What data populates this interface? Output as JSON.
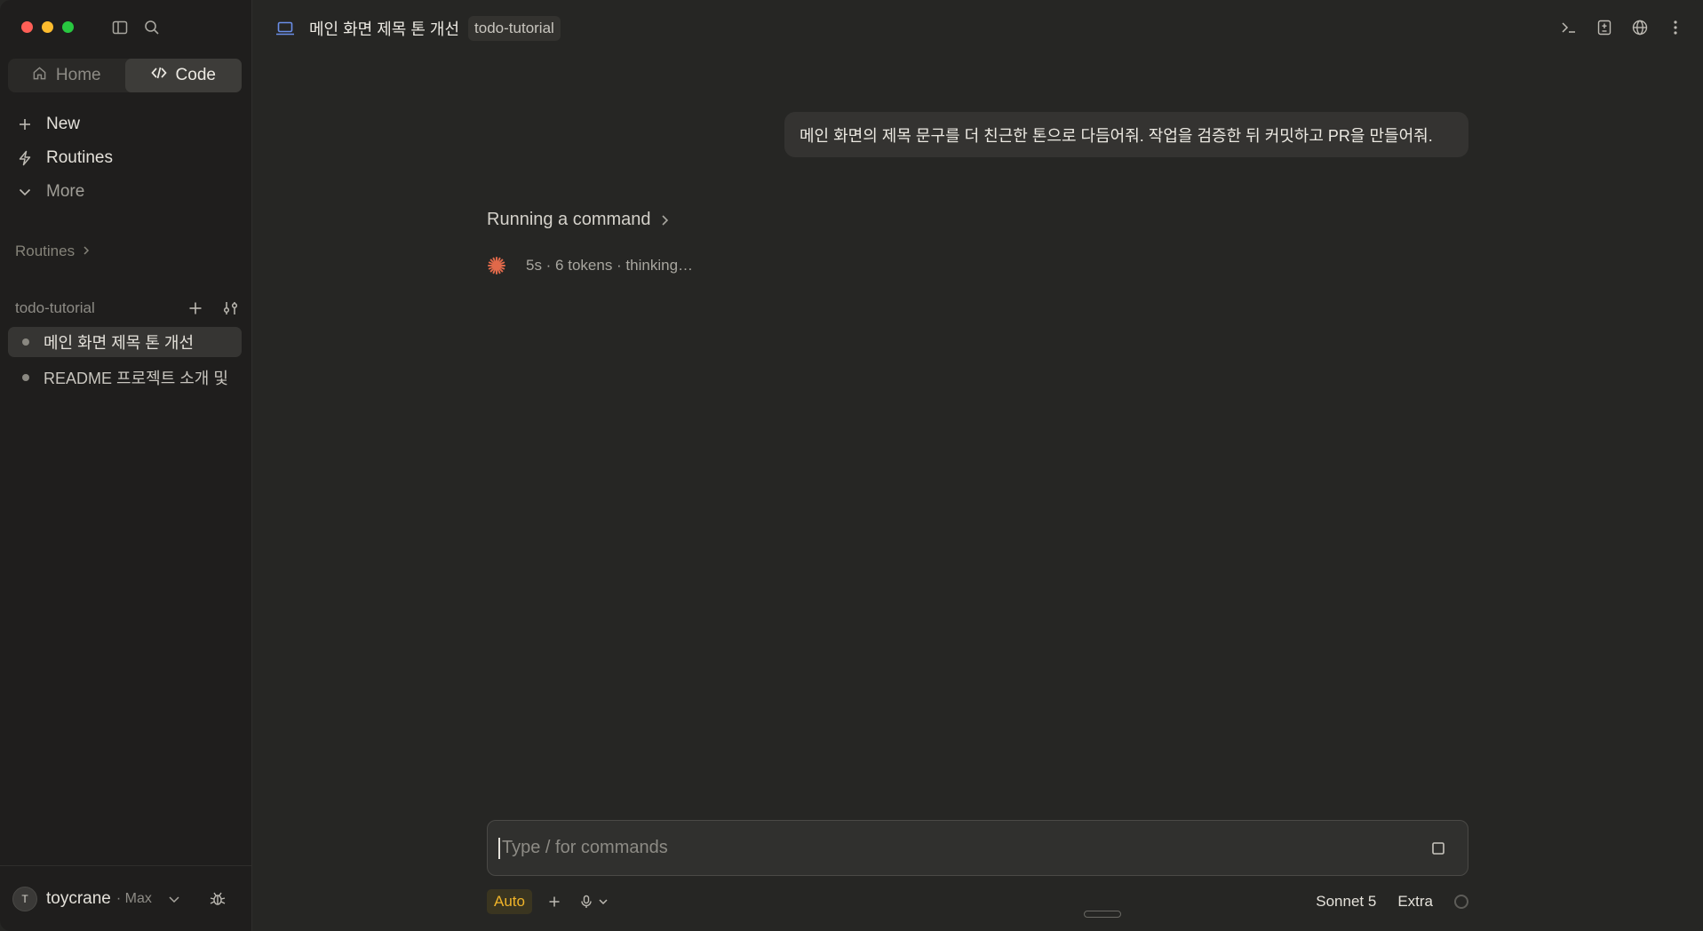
{
  "sidebar": {
    "segments": [
      {
        "label": "Home",
        "icon": "home-icon"
      },
      {
        "label": "Code",
        "icon": "code-icon"
      }
    ],
    "nav": [
      {
        "label": "New",
        "icon": "plus-icon"
      },
      {
        "label": "Routines",
        "icon": "bolt-icon"
      },
      {
        "label": "More",
        "icon": "chevron-down-icon"
      }
    ],
    "routines_section": "Routines",
    "project": {
      "name": "todo-tutorial",
      "sessions": [
        {
          "label": "메인 화면 제목 톤 개선"
        },
        {
          "label": "README 프로젝트 소개 및"
        }
      ]
    },
    "user": {
      "initial": "T",
      "name": "toycrane",
      "plan": "· Max"
    }
  },
  "header": {
    "title": "메인 화면 제목 톤 개선",
    "repo_chip": "todo-tutorial"
  },
  "conversation": {
    "user_message": "메인 화면의 제목 문구를 더 친근한 톤으로 다듬어줘. 작업을 검증한 뒤 커밋하고 PR을 만들어줘.",
    "status_title": "Running a command",
    "status_detail": "5s · 6 tokens · thinking…"
  },
  "composer": {
    "placeholder": "Type / for commands",
    "mode": "Auto",
    "model": "Sonnet 5",
    "effort": "Extra"
  },
  "colors": {
    "accent_orange": "#e0694a",
    "auto_yellow": "#f0b429",
    "laptop_blue": "#6a8ee8"
  }
}
